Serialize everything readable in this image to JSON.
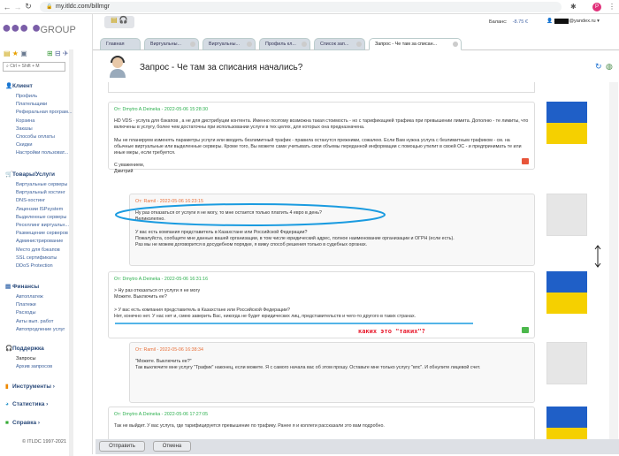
{
  "browser": {
    "url": "my.itldc.com/billmgr"
  },
  "logo": {
    "text": "ITL",
    "group": "GROUP"
  },
  "search": {
    "placeholder": "Ctrl + Shift + M"
  },
  "header": {
    "balance_label": "Баланс:",
    "balance_value": "-8.75 €",
    "user": "@yandex.ru"
  },
  "tabs": [
    {
      "label": "Главная"
    },
    {
      "label": "Виртуальны..."
    },
    {
      "label": "Виртуальны..."
    },
    {
      "label": "Профиль кл..."
    },
    {
      "label": "Список зап..."
    },
    {
      "label": "Запрос - Че там за списан..."
    }
  ],
  "page_title": "Запрос - Че там за списания начались?",
  "sidebar": {
    "client": {
      "title": "Клиент",
      "items": [
        "Профиль",
        "Плательщики",
        "Реферальная програм...",
        "Корзина",
        "Заказы",
        "Способы оплаты",
        "Скидки",
        "Настройки пользоват..."
      ]
    },
    "products": {
      "title": "Товары/Услуги",
      "items": [
        "Виртуальные серверы",
        "Виртуальный хостинг",
        "DNS-хостинг",
        "Лицензии ISPsystem",
        "Выделенные серверы",
        "Реселлинг виртуальн...",
        "Размещение серверов",
        "Администрирование",
        "Место для бэкапов",
        "SSL сертификаты",
        "DDoS Protection"
      ]
    },
    "finance": {
      "title": "Финансы",
      "items": [
        "Автоплатеж",
        "Платежи",
        "Расходы",
        "Акты вып. работ",
        "Автопродление услуг"
      ]
    },
    "support": {
      "title": "Поддержка",
      "items": [
        "Запросы",
        "Архив запросов"
      ]
    },
    "tools": {
      "title": "Инструменты"
    },
    "stats": {
      "title": "Статистика"
    },
    "help": {
      "title": "Справка"
    },
    "copyright": "© ITLDC 1997-2021"
  },
  "messages": [
    {
      "from": "От: Dmytro A.Deineka - 2022-05-06 15:28:30",
      "paragraphs": [
        "HD VDS - услуга для бэкапов , а не для дистрибуции контента. Именно поэтому возможна такая стоимость - но с тарификацией трафика при превышении лимита. Дополню - те лимиты, что включены в услугу, более чем достаточны при использовании услуги в тех целях, для которых она предназначена.",
        "Мы не планируем изменять параметры услуги или вводить безлимитный трафик - правила останутся прежними, сожалею. Если Вам нужна услуга с безлимитным трафиком - см. на обычные виртуальные или выделенные серверы. Кроме того, Вы можете сами учитывать свои объемы переданной информации с помощью утилит в своей ОС - и предпринимать те или иные меры, если требуется.",
        "С уважением,\nДмитрий"
      ]
    },
    {
      "from": "От: Ramil - 2022-05-06 16:23:15",
      "paragraphs": [
        "Ну раз отказаться от услуги я не могу, то мне остается только платить 4 евро в день?\nВеликолепно.",
        "У вас есть компания представитель в Казахстане или Российской Федерации?\nПожалуйста, сообщите мне данные вашей организации, в том числе юридический адрес, полное наименование организации и ОГРН (если есть).\nРаз мы не можем договорится в досудебном порядке, я вижу способ решения только в судебных органах."
      ]
    },
    {
      "from": "От: Dmytro A.Deineka - 2022-05-06 16:31:16",
      "paragraphs": [
        "> Ну раз отказаться от услуги я не могу\nМожете. Выключить ее?",
        "> У вас есть компания представитель в Казахстане или Российской Федерации?\nНет, конечно нет. У нас нет и, смею заверить Вас, никогда не будет юридических лиц, представительств и чего-то другого в таких странах."
      ]
    },
    {
      "from": "От: Ramil - 2022-05-06 16:38:34",
      "paragraphs": [
        "\"Можете. Выключить ее?\"\nТак выключите мне услугу \"Трафик\" наконец, если можете. Я с самого начала вас об этом прошу. Оставьте мне только услугу \"впс\". И обнулите лицевой счет."
      ]
    },
    {
      "from": "От: Dmytro A.Deineka - 2022-05-06 17:27:05",
      "paragraphs": [
        "Так не выйдет. У вас услуга, где тарифицируется превышение по трафику. Ранее я и коллеги рассказали это вам подробно."
      ]
    }
  ],
  "annotation": {
    "text": "каких это \"таких\"?"
  },
  "buttons": {
    "send": "Отправить",
    "cancel": "Отмена"
  },
  "colors": {
    "staff": "#2db04f",
    "client": "#e8703a",
    "annotation": "#e8192c",
    "highlight": "#1a9be0"
  }
}
